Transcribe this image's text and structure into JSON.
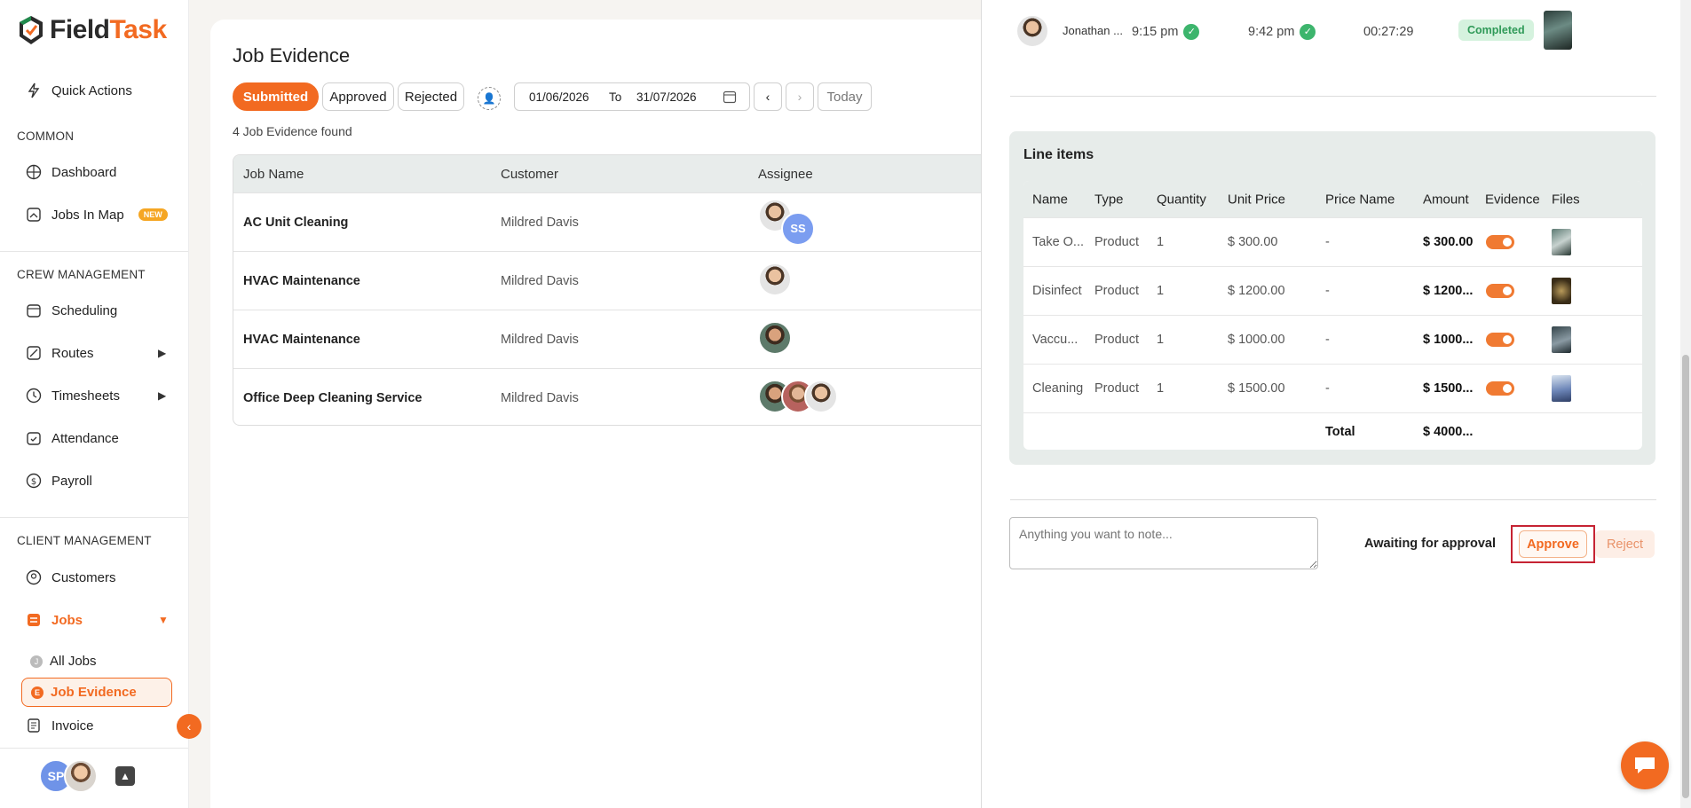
{
  "app": {
    "logo_field": "Field",
    "logo_task": "Task"
  },
  "sidebar": {
    "quick_actions": "Quick Actions",
    "sections": {
      "common": "COMMON",
      "crew": "CREW MANAGEMENT",
      "client": "CLIENT MANAGEMENT"
    },
    "items": {
      "dashboard": "Dashboard",
      "jobs_in_map": "Jobs In Map",
      "new_badge": "NEW",
      "scheduling": "Scheduling",
      "routes": "Routes",
      "timesheets": "Timesheets",
      "attendance": "Attendance",
      "payroll": "Payroll",
      "customers": "Customers",
      "jobs": "Jobs",
      "all_jobs": "All Jobs",
      "job_evidence": "Job Evidence",
      "invoice": "Invoice"
    },
    "sub_letters": {
      "all_jobs": "J",
      "job_evidence": "E"
    },
    "user_initials": "SP"
  },
  "main": {
    "title": "Job Evidence",
    "tabs": [
      "Submitted",
      "Approved",
      "Rejected"
    ],
    "date_from": "01/06/2026",
    "date_to_label": "To",
    "date_to": "31/07/2026",
    "today": "Today",
    "found": "4 Job Evidence found",
    "columns": [
      "Job Name",
      "Customer",
      "Assignee"
    ],
    "rows": [
      {
        "job": "AC Unit Cleaning",
        "customer": "Mildred Davis",
        "extra_initials": "SS"
      },
      {
        "job": "HVAC Maintenance",
        "customer": "Mildred Davis"
      },
      {
        "job": "HVAC Maintenance",
        "customer": "Mildred Davis"
      },
      {
        "job": "Office Deep Cleaning Service",
        "customer": "Mildred Davis"
      }
    ]
  },
  "drawer": {
    "timesheet": {
      "name": "Jonathan ...",
      "start": "9:15 pm",
      "end": "9:42 pm",
      "duration": "00:27:29",
      "status": "Completed"
    },
    "line_items": {
      "title": "Line items",
      "columns": [
        "Name",
        "Type",
        "Quantity",
        "Unit Price",
        "Price Name",
        "Amount",
        "Evidence",
        "Files"
      ],
      "rows": [
        {
          "name": "Take O...",
          "type": "Product",
          "qty": "1",
          "unit": "$ 300.00",
          "price_name": "-",
          "amount": "$ 300.00"
        },
        {
          "name": "Disinfect",
          "type": "Product",
          "qty": "1",
          "unit": "$ 1200.00",
          "price_name": "-",
          "amount": "$ 1200..."
        },
        {
          "name": "Vaccu...",
          "type": "Product",
          "qty": "1",
          "unit": "$ 1000.00",
          "price_name": "-",
          "amount": "$ 1000..."
        },
        {
          "name": "Cleaning",
          "type": "Product",
          "qty": "1",
          "unit": "$ 1500.00",
          "price_name": "-",
          "amount": "$ 1500..."
        }
      ],
      "total_label": "Total",
      "total": "$ 4000..."
    },
    "note_placeholder": "Anything you want to note...",
    "awaiting": "Awaiting for approval",
    "approve": "Approve",
    "reject": "Reject"
  },
  "colors": {
    "accent": "#f26a21",
    "success": "#3db56d",
    "highlight": "#c62333"
  }
}
